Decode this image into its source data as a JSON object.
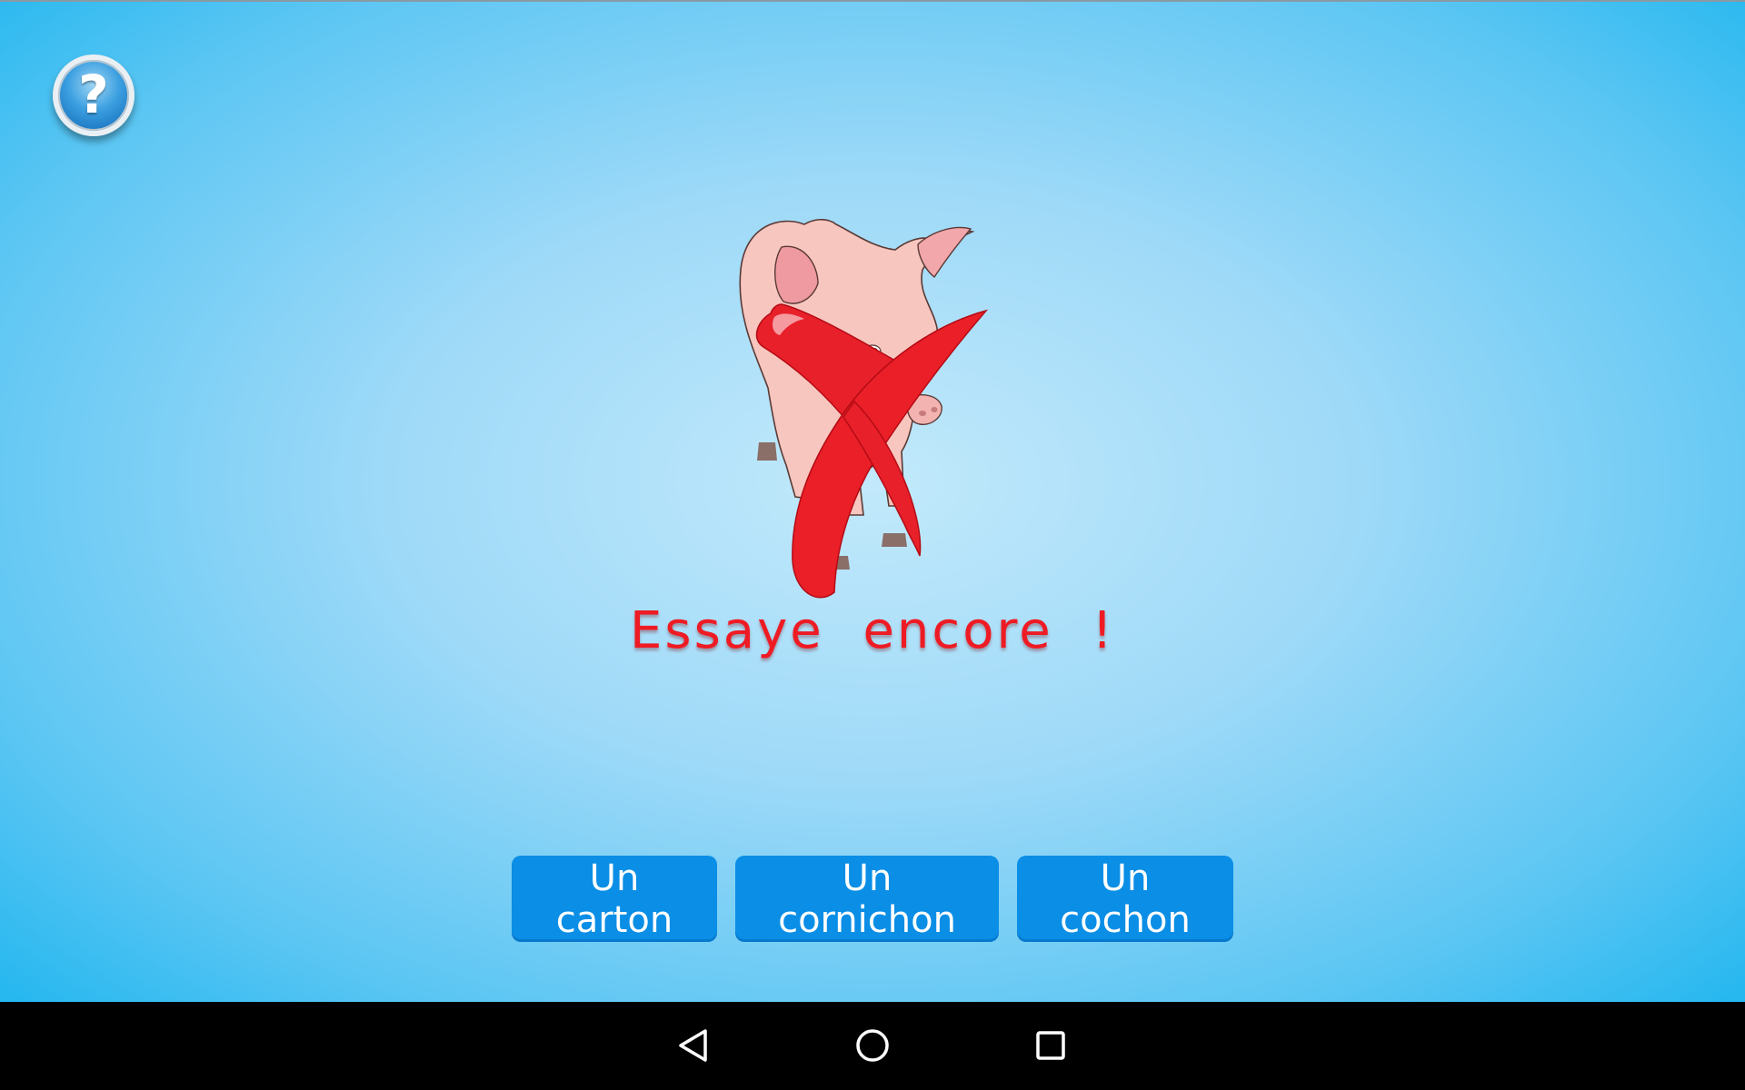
{
  "help": {
    "icon": "question-mark-icon",
    "glyph": "?"
  },
  "illustration": {
    "subject_icon": "pig-icon",
    "overlay_icon": "red-cross-icon"
  },
  "feedback": {
    "text": "Essaye encore !"
  },
  "choices": [
    {
      "label": "Un carton"
    },
    {
      "label": "Un cornichon"
    },
    {
      "label": "Un cochon"
    }
  ],
  "navbar": {
    "back_icon": "back-triangle-icon",
    "home_icon": "home-circle-icon",
    "recents_icon": "recents-square-icon"
  },
  "colors": {
    "feedback_text": "#ee1b24",
    "choice_button": "#0a8ee6",
    "background_center": "#c2e9fb",
    "background_edge": "#12b2ee"
  }
}
